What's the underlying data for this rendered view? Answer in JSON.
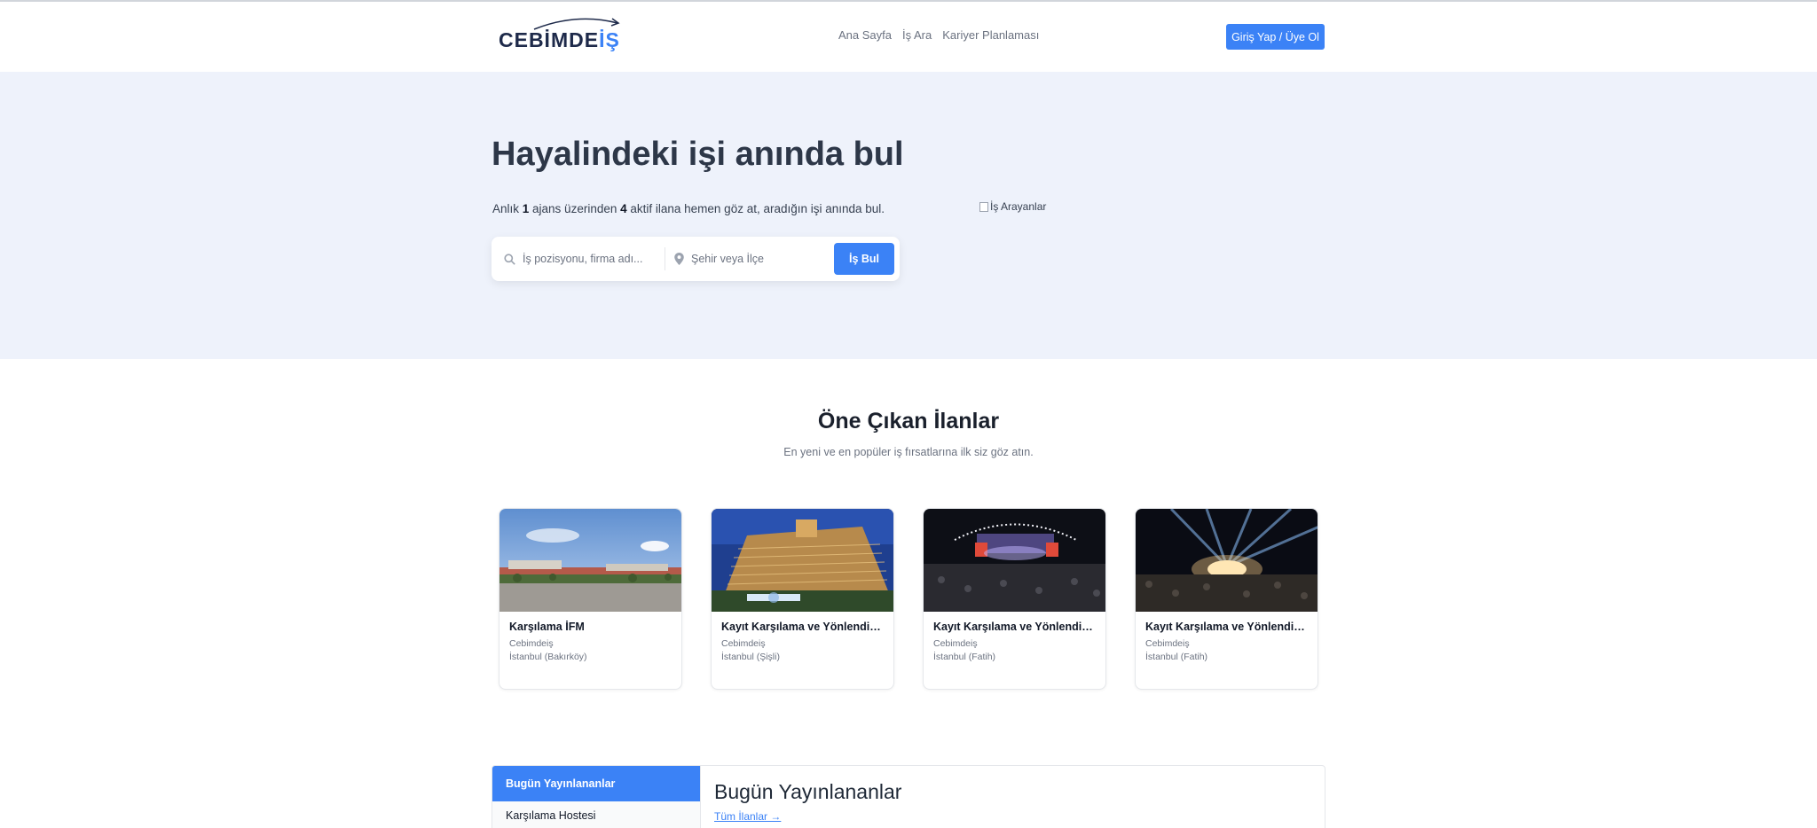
{
  "header": {
    "logo_text_main": "CEBİMDE",
    "logo_text_accent": "İŞ",
    "nav": [
      "Ana Sayfa",
      "İş Ara",
      "Kariyer Planlaması"
    ],
    "login_label": "Giriş Yap / Üye Ol"
  },
  "hero": {
    "title": "Hayalindeki işi anında bul",
    "sub_pre": "Anlık ",
    "agency_count": "1",
    "sub_mid": " ajans üzerinden ",
    "listing_count": "4",
    "sub_post": " aktif ilana hemen göz at, aradığın işi anında bul.",
    "image_alt": "İş Arayanlar",
    "search": {
      "job_placeholder": "İş pozisyonu, firma adı...",
      "location_placeholder": "Şehir veya İlçe",
      "button_label": "İş Bul"
    }
  },
  "featured": {
    "title": "Öne Çıkan İlanlar",
    "subtitle": "En yeni ve en popüler iş fırsatlarına ilk siz göz atın.",
    "cards": [
      {
        "title": "Karşılama İFM",
        "company": "Cebimdeiş",
        "location": "İstanbul (Bakırköy)"
      },
      {
        "title": "Kayıt Karşılama ve Yönlendirme",
        "company": "Cebimdeiş",
        "location": "İstanbul (Şişli)"
      },
      {
        "title": "Kayıt Karşılama ve Yönlendirme",
        "company": "Cebimdeiş",
        "location": "İstanbul (Fatih)"
      },
      {
        "title": "Kayıt Karşılama ve Yönlendirme",
        "company": "Cebimdeiş",
        "location": "İstanbul (Fatih)"
      }
    ]
  },
  "listings": {
    "active_tab": "Bugün Yayınlananlar",
    "items": [
      "Karşılama Hostesi"
    ],
    "panel_title": "Bugün Yayınlananlar",
    "all_link": "Tüm İlanlar →"
  }
}
